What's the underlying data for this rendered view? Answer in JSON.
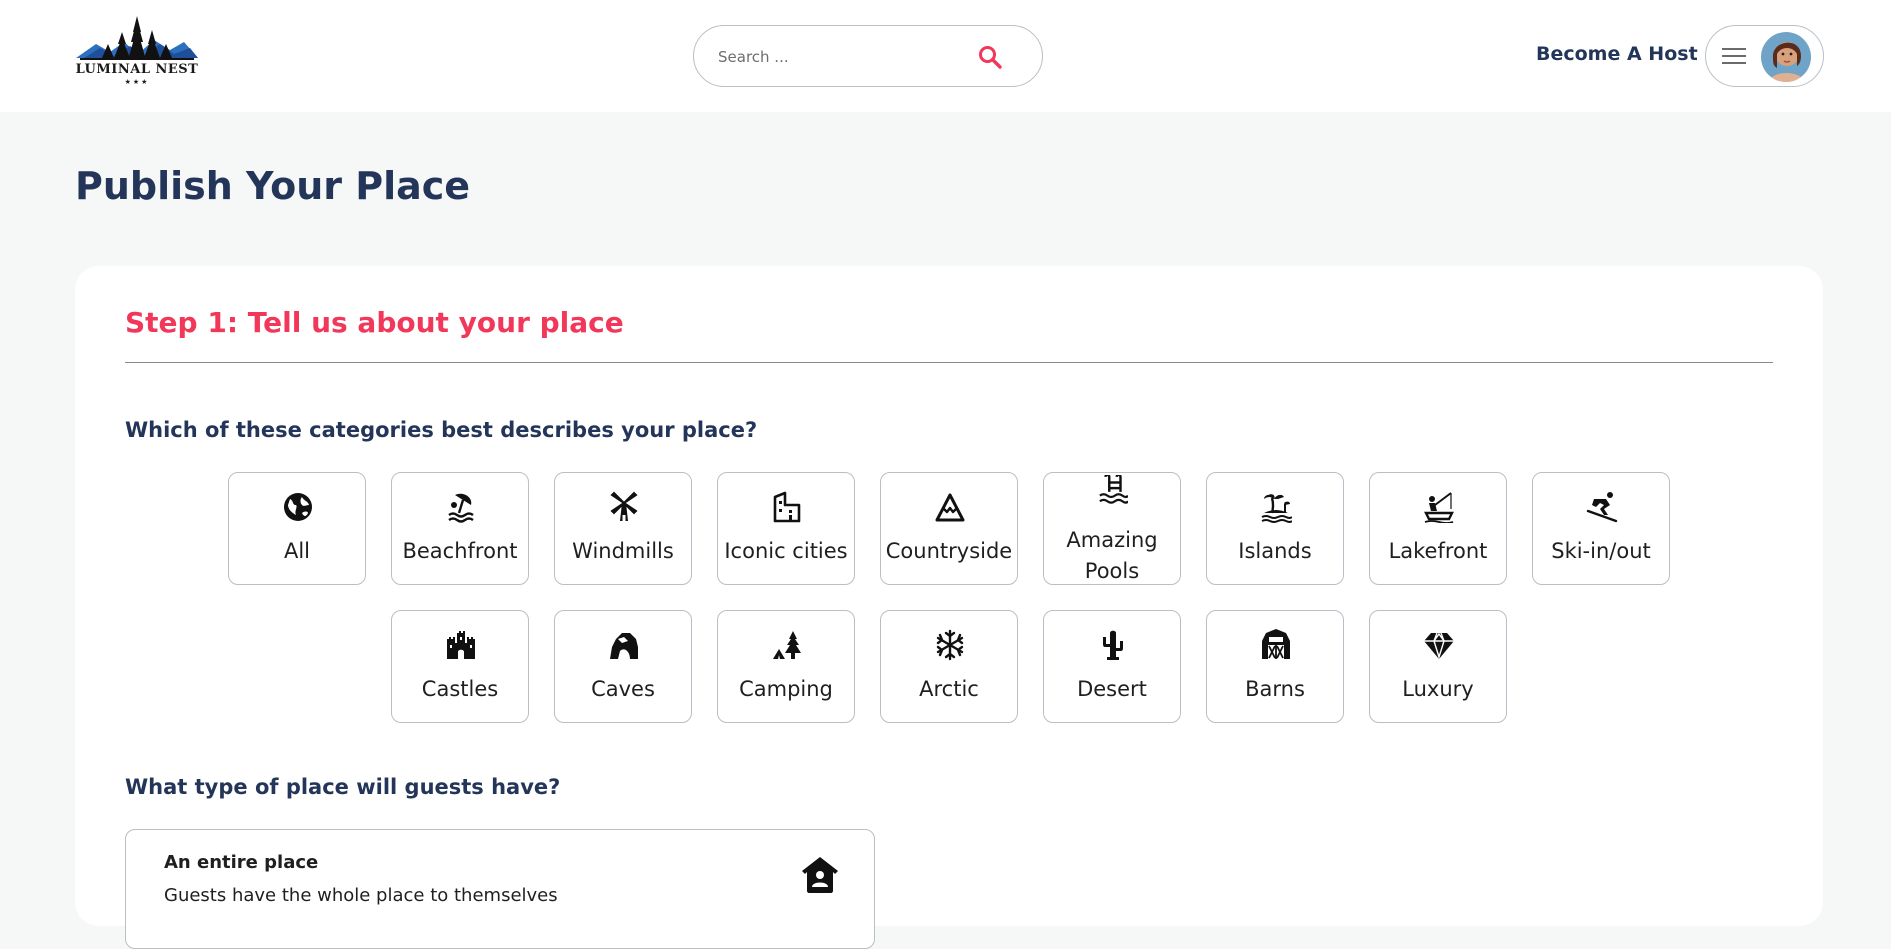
{
  "header": {
    "logo": {
      "name": "LUMINAL NEST",
      "stars": "★★★"
    },
    "search": {
      "placeholder": "Search ..."
    },
    "become_host": "Become A Host"
  },
  "page": {
    "title": "Publish Your Place"
  },
  "step": {
    "title": "Step 1: Tell us about your place"
  },
  "categories_question": "Which of these categories best describes your place?",
  "categories_row1": [
    {
      "label": "All",
      "icon": "globe-icon"
    },
    {
      "label": "Beachfront",
      "icon": "beach-umbrella-icon"
    },
    {
      "label": "Windmills",
      "icon": "windmill-icon"
    },
    {
      "label": "Iconic cities",
      "icon": "city-building-icon"
    },
    {
      "label": "Countryside",
      "icon": "mountain-icon"
    },
    {
      "label": "Amazing Pools",
      "icon": "pool-ladder-icon"
    },
    {
      "label": "Islands",
      "icon": "palm-island-icon"
    },
    {
      "label": "Lakefront",
      "icon": "fishing-icon"
    },
    {
      "label": "Ski-in/out",
      "icon": "skiing-icon"
    }
  ],
  "categories_row2": [
    {
      "label": "Castles",
      "icon": "castle-icon"
    },
    {
      "label": "Caves",
      "icon": "cave-icon"
    },
    {
      "label": "Camping",
      "icon": "tent-tree-icon"
    },
    {
      "label": "Arctic",
      "icon": "snowflake-icon"
    },
    {
      "label": "Desert",
      "icon": "cactus-icon"
    },
    {
      "label": "Barns",
      "icon": "barn-icon"
    },
    {
      "label": "Luxury",
      "icon": "diamond-icon"
    }
  ],
  "place_type_question": "What type of place will guests have?",
  "place_options": [
    {
      "title": "An entire place",
      "description": "Guests have the whole place to themselves",
      "icon": "house-user-icon"
    }
  ],
  "colors": {
    "accent": "#f2385a",
    "navy": "#24355a",
    "page_bg": "#f6f8f7"
  }
}
